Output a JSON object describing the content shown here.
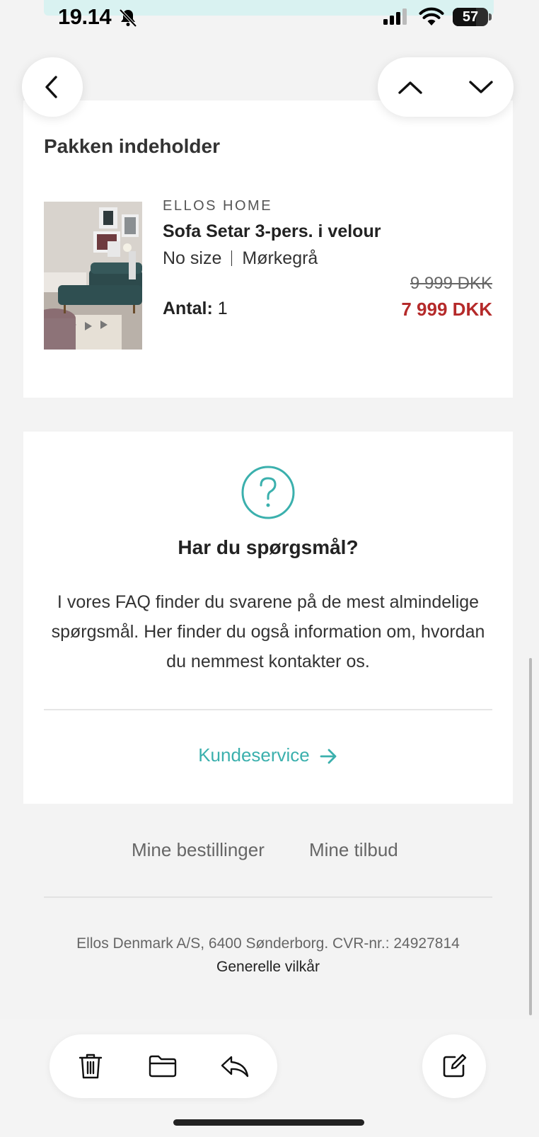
{
  "status_bar": {
    "time": "19.14",
    "battery": "57",
    "icons": [
      "bell-muted-icon",
      "signal-icon",
      "wifi-icon",
      "battery-icon"
    ]
  },
  "nav": {
    "icons": [
      "chevron-left-icon",
      "chevron-up-icon",
      "chevron-down-icon"
    ]
  },
  "package": {
    "title": "Pakken indeholder",
    "item": {
      "brand": "ELLOS HOME",
      "name": "Sofa Setar 3-pers. i velour",
      "size": "No size",
      "color": "Mørkegrå",
      "qty_label": "Antal:",
      "qty_value": "1",
      "price_old": "9 999 DKK",
      "price_new": "7 999 DKK"
    }
  },
  "faq": {
    "title": "Har du spørgsmål?",
    "body": "I vores FAQ finder du svarene på de mest almindelige spørgsmål. Her finder du også information om, hvordan du nemmest kontakter os.",
    "link": "Kundeservice",
    "accent": "#3bb0ad"
  },
  "footer": {
    "links": [
      "Mine bestillinger",
      "Mine tilbud"
    ],
    "company": "Ellos Denmark A/S, 6400 Sønderborg. CVR-nr.: 24927814",
    "terms": "Generelle vilkår"
  },
  "toolbar": {
    "icons": [
      "trash-icon",
      "folder-icon",
      "reply-icon",
      "compose-icon"
    ]
  },
  "colors": {
    "sale_price": "#b52a2a",
    "background": "#f3f3f3"
  }
}
